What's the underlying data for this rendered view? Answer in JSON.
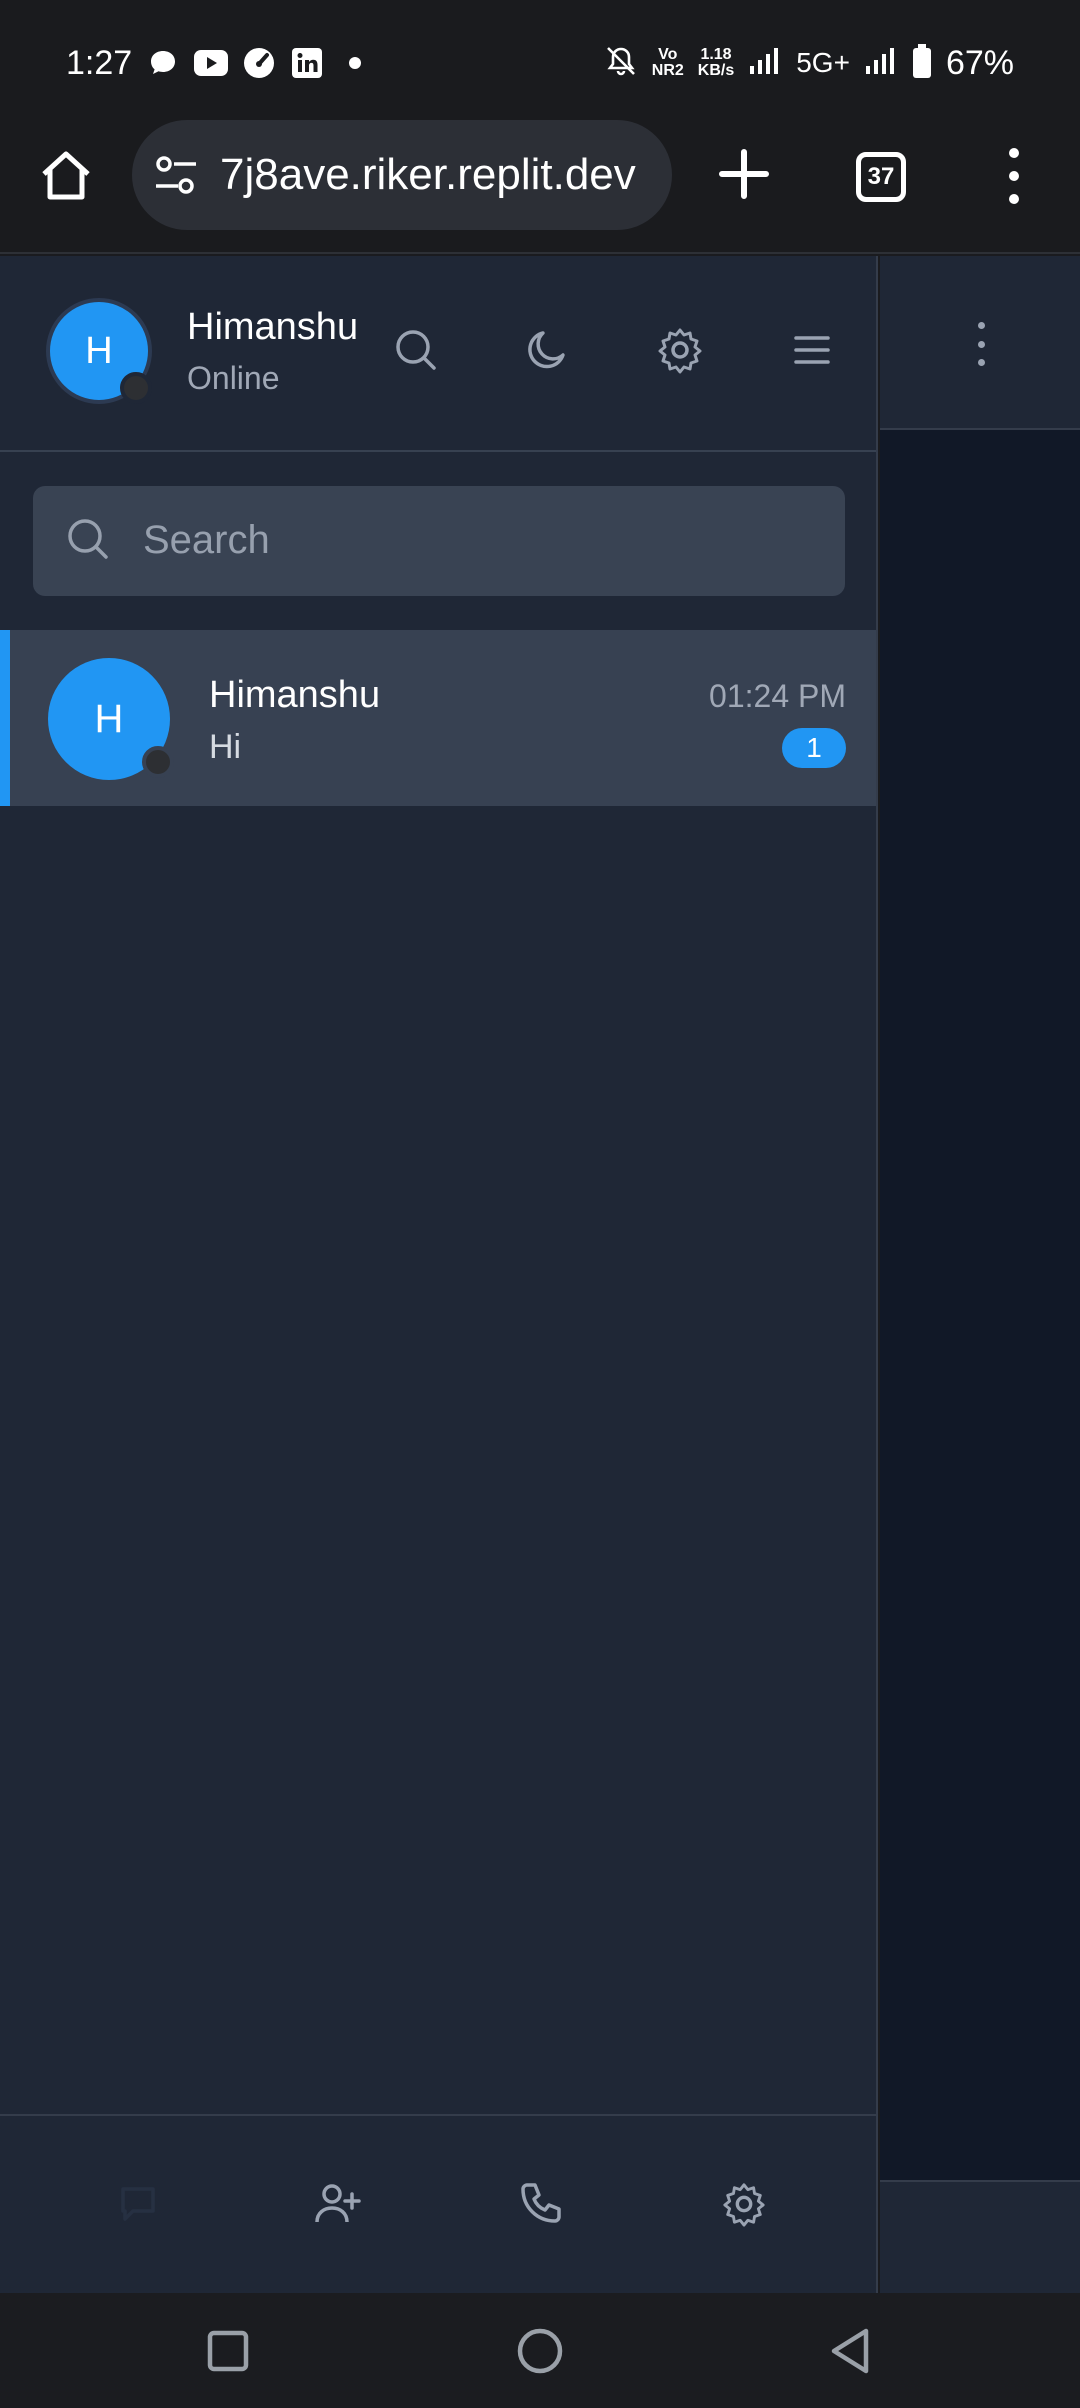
{
  "status_bar": {
    "time": "1:27",
    "net_speed_value": "1.18",
    "net_speed_unit": "KB/s",
    "volte_top": "Vo",
    "volte_bottom": "NR2",
    "network": "5G+",
    "battery": "67%",
    "notification_icons": [
      "threads-icon",
      "youtube-icon",
      "speedometer-icon",
      "linkedin-icon",
      "dot-icon"
    ]
  },
  "browser": {
    "url": "7j8ave.riker.replit.dev",
    "tab_count": "37"
  },
  "profile": {
    "initial": "H",
    "name": "Himanshu",
    "status": "Online"
  },
  "search": {
    "placeholder": "Search"
  },
  "chats": [
    {
      "initial": "H",
      "name": "Himanshu",
      "preview": "Hi",
      "time": "01:24 PM",
      "unread": "1"
    }
  ],
  "colors": {
    "accent": "#2196f3",
    "sidebar_bg": "#1f2736",
    "active_item_bg": "#374152",
    "pane_bg": "#111827"
  }
}
